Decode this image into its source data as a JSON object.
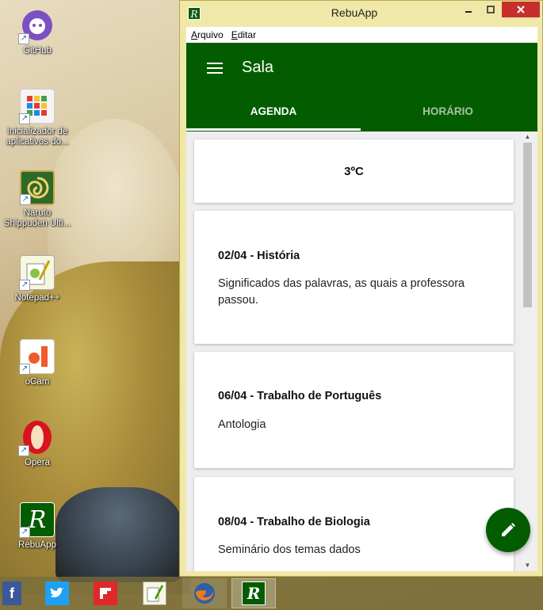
{
  "desktop": {
    "icons": [
      {
        "label": "GitHub",
        "icon": "github-icon"
      },
      {
        "label": "Inicializador de aplicativos do...",
        "icon": "app-launcher-icon"
      },
      {
        "label": "Naruto Shippuden Ulti...",
        "icon": "naruto-icon"
      },
      {
        "label": "Notepad++",
        "icon": "notepad-icon"
      },
      {
        "label": "oCam",
        "icon": "ocam-icon"
      },
      {
        "label": "Opera",
        "icon": "opera-icon"
      },
      {
        "label": "RebuApp",
        "icon": "rebuapp-icon"
      }
    ]
  },
  "taskbar": {
    "items": [
      "facebook-icon",
      "twitter-icon",
      "flipboard-icon",
      "notepad-icon",
      "firefox-icon",
      "rebuapp-icon"
    ]
  },
  "window": {
    "title": "RebuApp",
    "menu": [
      "Arquivo",
      "Editar"
    ]
  },
  "app": {
    "title": "Sala",
    "tabs": [
      {
        "label": "AGENDA"
      },
      {
        "label": "HORÁRIO"
      }
    ],
    "weather": "3ºC",
    "events": [
      {
        "title": "02/04 - História",
        "desc": "Significados das palavras, as quais a professora passou."
      },
      {
        "title": "06/04 - Trabalho de Português",
        "desc": "Antologia"
      },
      {
        "title": "08/04 - Trabalho de Biologia",
        "desc": "Seminário dos temas dados"
      }
    ]
  },
  "colors": {
    "primary": "#035c00",
    "window_frame": "#f0e8a8",
    "close_button": "#c7302a"
  }
}
